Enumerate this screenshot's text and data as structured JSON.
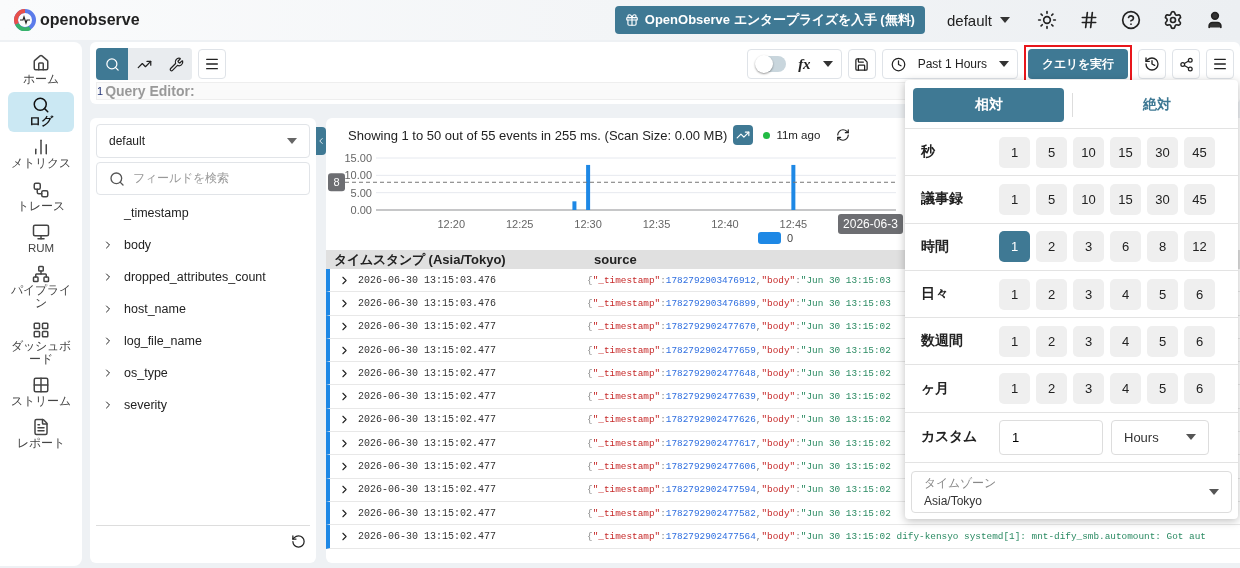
{
  "header": {
    "logo_text": "openobserve",
    "enterprise_button": "OpenObserve エンタープライズを入手 (無料)",
    "org": "default"
  },
  "nav": [
    {
      "label": "ホーム",
      "selected": false
    },
    {
      "label": "ログ",
      "selected": true
    },
    {
      "label": "メトリクス",
      "selected": false
    },
    {
      "label": "トレース",
      "selected": false
    },
    {
      "label": "RUM",
      "selected": false
    },
    {
      "label": "パイプライン",
      "selected": false
    },
    {
      "label": "ダッシュボード",
      "selected": false
    },
    {
      "label": "ストリーム",
      "selected": false
    },
    {
      "label": "レポート",
      "selected": false
    }
  ],
  "toolbar": {
    "modes": [
      {
        "selected": true
      },
      {
        "selected": false
      },
      {
        "selected": false
      }
    ],
    "function_toggle": {
      "on": false
    },
    "fx": "fx",
    "time_range": "Past 1 Hours",
    "run_button": {
      "label": "クエリを実行",
      "highlighted": true
    }
  },
  "query_editor": {
    "line_number": "1",
    "placeholder": "Query Editor:"
  },
  "fields": {
    "stream": "default",
    "search_placeholder": "フィールドを検索",
    "items": [
      {
        "name": "_timestamp",
        "expandable": false
      },
      {
        "name": "body",
        "expandable": true
      },
      {
        "name": "dropped_attributes_count",
        "expandable": true
      },
      {
        "name": "host_name",
        "expandable": true
      },
      {
        "name": "log_file_name",
        "expandable": true
      },
      {
        "name": "os_type",
        "expandable": true
      },
      {
        "name": "severity",
        "expandable": true
      }
    ]
  },
  "results": {
    "summary": "Showing 1 to 50 out of 55 events in 255 ms. (Scan Size: 0.00 MB)",
    "status": "11m ago",
    "chart_data": {
      "type": "bar",
      "categories": [
        null,
        null,
        null,
        null,
        null,
        "12:20",
        null,
        null,
        null,
        null,
        "12:25",
        null,
        null,
        null,
        null,
        "12:30",
        null,
        null,
        null,
        null,
        "12:35",
        null,
        null,
        null,
        null,
        "12:40",
        null,
        null,
        null,
        null,
        "12:45",
        null,
        null,
        null,
        null,
        null,
        null,
        null
      ],
      "series": [
        {
          "name": "0",
          "color": "#1e88e5",
          "values": [
            null,
            null,
            null,
            null,
            null,
            null,
            null,
            null,
            null,
            null,
            null,
            null,
            null,
            null,
            2.5,
            13,
            null,
            null,
            null,
            null,
            null,
            null,
            null,
            null,
            null,
            null,
            null,
            null,
            null,
            null,
            13,
            null,
            null,
            null,
            null,
            null,
            null,
            null
          ]
        }
      ],
      "ylim": [
        0,
        15
      ],
      "yticks": [
        {
          "value": 0,
          "label": "0.00"
        },
        {
          "value": 5,
          "label": "5.00"
        },
        {
          "value": 10,
          "label": "10.00"
        },
        {
          "value": 15,
          "label": "15.00"
        }
      ],
      "ref_lines": [
        {
          "axis": "y",
          "value": 8,
          "label": "8"
        }
      ],
      "annotations": [
        {
          "text": "2026-06-3"
        }
      ]
    },
    "columns": [
      "タイムスタンプ (Asia/Tokyo)",
      "source"
    ],
    "rows": [
      {
        "timestamp": "2026-06-30 13:15:03.476",
        "source": [
          {
            "kind": "punct",
            "text": "{"
          },
          {
            "kind": "key",
            "text": "\"_timestamp\""
          },
          {
            "kind": "punct",
            "text": ":"
          },
          {
            "kind": "number",
            "text": "1782792903476912"
          },
          {
            "kind": "punct",
            "text": ","
          },
          {
            "kind": "key",
            "text": "\"body\""
          },
          {
            "kind": "punct",
            "text": ":"
          },
          {
            "kind": "string",
            "text": "\"Jun 30 13:15:03"
          }
        ]
      },
      {
        "timestamp": "2026-06-30 13:15:03.476",
        "source": [
          {
            "kind": "punct",
            "text": "{"
          },
          {
            "kind": "key",
            "text": "\"_timestamp\""
          },
          {
            "kind": "punct",
            "text": ":"
          },
          {
            "kind": "number",
            "text": "1782792903476899"
          },
          {
            "kind": "punct",
            "text": ","
          },
          {
            "kind": "key",
            "text": "\"body\""
          },
          {
            "kind": "punct",
            "text": ":"
          },
          {
            "kind": "string",
            "text": "\"Jun 30 13:15:03"
          }
        ]
      },
      {
        "timestamp": "2026-06-30 13:15:02.477",
        "source": [
          {
            "kind": "punct",
            "text": "{"
          },
          {
            "kind": "key",
            "text": "\"_timestamp\""
          },
          {
            "kind": "punct",
            "text": ":"
          },
          {
            "kind": "number",
            "text": "1782792902477670"
          },
          {
            "kind": "punct",
            "text": ","
          },
          {
            "kind": "key",
            "text": "\"body\""
          },
          {
            "kind": "punct",
            "text": ":"
          },
          {
            "kind": "string",
            "text": "\"Jun 30 13:15:02"
          }
        ]
      },
      {
        "timestamp": "2026-06-30 13:15:02.477",
        "source": [
          {
            "kind": "punct",
            "text": "{"
          },
          {
            "kind": "key",
            "text": "\"_timestamp\""
          },
          {
            "kind": "punct",
            "text": ":"
          },
          {
            "kind": "number",
            "text": "1782792902477659"
          },
          {
            "kind": "punct",
            "text": ","
          },
          {
            "kind": "key",
            "text": "\"body\""
          },
          {
            "kind": "punct",
            "text": ":"
          },
          {
            "kind": "string",
            "text": "\"Jun 30 13:15:02"
          }
        ]
      },
      {
        "timestamp": "2026-06-30 13:15:02.477",
        "source": [
          {
            "kind": "punct",
            "text": "{"
          },
          {
            "kind": "key",
            "text": "\"_timestamp\""
          },
          {
            "kind": "punct",
            "text": ":"
          },
          {
            "kind": "number",
            "text": "1782792902477648"
          },
          {
            "kind": "punct",
            "text": ","
          },
          {
            "kind": "key",
            "text": "\"body\""
          },
          {
            "kind": "punct",
            "text": ":"
          },
          {
            "kind": "string",
            "text": "\"Jun 30 13:15:02"
          }
        ]
      },
      {
        "timestamp": "2026-06-30 13:15:02.477",
        "source": [
          {
            "kind": "punct",
            "text": "{"
          },
          {
            "kind": "key",
            "text": "\"_timestamp\""
          },
          {
            "kind": "punct",
            "text": ":"
          },
          {
            "kind": "number",
            "text": "1782792902477639"
          },
          {
            "kind": "punct",
            "text": ","
          },
          {
            "kind": "key",
            "text": "\"body\""
          },
          {
            "kind": "punct",
            "text": ":"
          },
          {
            "kind": "string",
            "text": "\"Jun 30 13:15:02"
          }
        ]
      },
      {
        "timestamp": "2026-06-30 13:15:02.477",
        "source": [
          {
            "kind": "punct",
            "text": "{"
          },
          {
            "kind": "key",
            "text": "\"_timestamp\""
          },
          {
            "kind": "punct",
            "text": ":"
          },
          {
            "kind": "number",
            "text": "1782792902477626"
          },
          {
            "kind": "punct",
            "text": ","
          },
          {
            "kind": "key",
            "text": "\"body\""
          },
          {
            "kind": "punct",
            "text": ":"
          },
          {
            "kind": "string",
            "text": "\"Jun 30 13:15:02"
          }
        ]
      },
      {
        "timestamp": "2026-06-30 13:15:02.477",
        "source": [
          {
            "kind": "punct",
            "text": "{"
          },
          {
            "kind": "key",
            "text": "\"_timestamp\""
          },
          {
            "kind": "punct",
            "text": ":"
          },
          {
            "kind": "number",
            "text": "1782792902477617"
          },
          {
            "kind": "punct",
            "text": ","
          },
          {
            "kind": "key",
            "text": "\"body\""
          },
          {
            "kind": "punct",
            "text": ":"
          },
          {
            "kind": "string",
            "text": "\"Jun 30 13:15:02"
          }
        ]
      },
      {
        "timestamp": "2026-06-30 13:15:02.477",
        "source": [
          {
            "kind": "punct",
            "text": "{"
          },
          {
            "kind": "key",
            "text": "\"_timestamp\""
          },
          {
            "kind": "punct",
            "text": ":"
          },
          {
            "kind": "number",
            "text": "1782792902477606"
          },
          {
            "kind": "punct",
            "text": ","
          },
          {
            "kind": "key",
            "text": "\"body\""
          },
          {
            "kind": "punct",
            "text": ":"
          },
          {
            "kind": "string",
            "text": "\"Jun 30 13:15:02"
          }
        ]
      },
      {
        "timestamp": "2026-06-30 13:15:02.477",
        "source": [
          {
            "kind": "punct",
            "text": "{"
          },
          {
            "kind": "key",
            "text": "\"_timestamp\""
          },
          {
            "kind": "punct",
            "text": ":"
          },
          {
            "kind": "number",
            "text": "1782792902477594"
          },
          {
            "kind": "punct",
            "text": ","
          },
          {
            "kind": "key",
            "text": "\"body\""
          },
          {
            "kind": "punct",
            "text": ":"
          },
          {
            "kind": "string",
            "text": "\"Jun 30 13:15:02"
          }
        ]
      },
      {
        "timestamp": "2026-06-30 13:15:02.477",
        "source": [
          {
            "kind": "punct",
            "text": "{"
          },
          {
            "kind": "key",
            "text": "\"_timestamp\""
          },
          {
            "kind": "punct",
            "text": ":"
          },
          {
            "kind": "number",
            "text": "1782792902477582"
          },
          {
            "kind": "punct",
            "text": ","
          },
          {
            "kind": "key",
            "text": "\"body\""
          },
          {
            "kind": "punct",
            "text": ":"
          },
          {
            "kind": "string",
            "text": "\"Jun 30 13:15:02"
          }
        ]
      },
      {
        "timestamp": "2026-06-30 13:15:02.477",
        "source": [
          {
            "kind": "punct",
            "text": "{"
          },
          {
            "kind": "key",
            "text": "\"_timestamp\""
          },
          {
            "kind": "punct",
            "text": ":"
          },
          {
            "kind": "number",
            "text": "1782792902477564"
          },
          {
            "kind": "punct",
            "text": ","
          },
          {
            "kind": "key",
            "text": "\"body\""
          },
          {
            "kind": "punct",
            "text": ":"
          },
          {
            "kind": "string",
            "text": "\"Jun 30 13:15:02 dify-kensyo systemd[1]: mnt-dify_smb.automount: Got aut"
          }
        ]
      }
    ]
  },
  "time_picker": {
    "tabs": [
      {
        "label": "相対",
        "selected": true
      },
      {
        "label": "絶対",
        "selected": false
      }
    ],
    "units": [
      {
        "label": "秒",
        "options": [
          {
            "value": "1",
            "selected": false
          },
          {
            "value": "5",
            "selected": false
          },
          {
            "value": "10",
            "selected": false
          },
          {
            "value": "15",
            "selected": false
          },
          {
            "value": "30",
            "selected": false
          },
          {
            "value": "45",
            "selected": false
          }
        ]
      },
      {
        "label": "議事録",
        "options": [
          {
            "value": "1",
            "selected": false
          },
          {
            "value": "5",
            "selected": false
          },
          {
            "value": "10",
            "selected": false
          },
          {
            "value": "15",
            "selected": false
          },
          {
            "value": "30",
            "selected": false
          },
          {
            "value": "45",
            "selected": false
          }
        ]
      },
      {
        "label": "時間",
        "options": [
          {
            "value": "1",
            "selected": true
          },
          {
            "value": "2",
            "selected": false
          },
          {
            "value": "3",
            "selected": false
          },
          {
            "value": "6",
            "selected": false
          },
          {
            "value": "8",
            "selected": false
          },
          {
            "value": "12",
            "selected": false
          }
        ]
      },
      {
        "label": "日々",
        "options": [
          {
            "value": "1",
            "selected": false
          },
          {
            "value": "2",
            "selected": false
          },
          {
            "value": "3",
            "selected": false
          },
          {
            "value": "4",
            "selected": false
          },
          {
            "value": "5",
            "selected": false
          },
          {
            "value": "6",
            "selected": false
          }
        ]
      },
      {
        "label": "数週間",
        "options": [
          {
            "value": "1",
            "selected": false
          },
          {
            "value": "2",
            "selected": false
          },
          {
            "value": "3",
            "selected": false
          },
          {
            "value": "4",
            "selected": false
          },
          {
            "value": "5",
            "selected": false
          },
          {
            "value": "6",
            "selected": false
          }
        ]
      },
      {
        "label": "ヶ月",
        "options": [
          {
            "value": "1",
            "selected": false
          },
          {
            "value": "2",
            "selected": false
          },
          {
            "value": "3",
            "selected": false
          },
          {
            "value": "4",
            "selected": false
          },
          {
            "value": "5",
            "selected": false
          },
          {
            "value": "6",
            "selected": false
          }
        ]
      }
    ],
    "custom": {
      "label": "カスタム",
      "value": "1",
      "unit": "Hours"
    },
    "timezone": {
      "label": "タイムゾーン",
      "value": "Asia/Tokyo"
    }
  }
}
